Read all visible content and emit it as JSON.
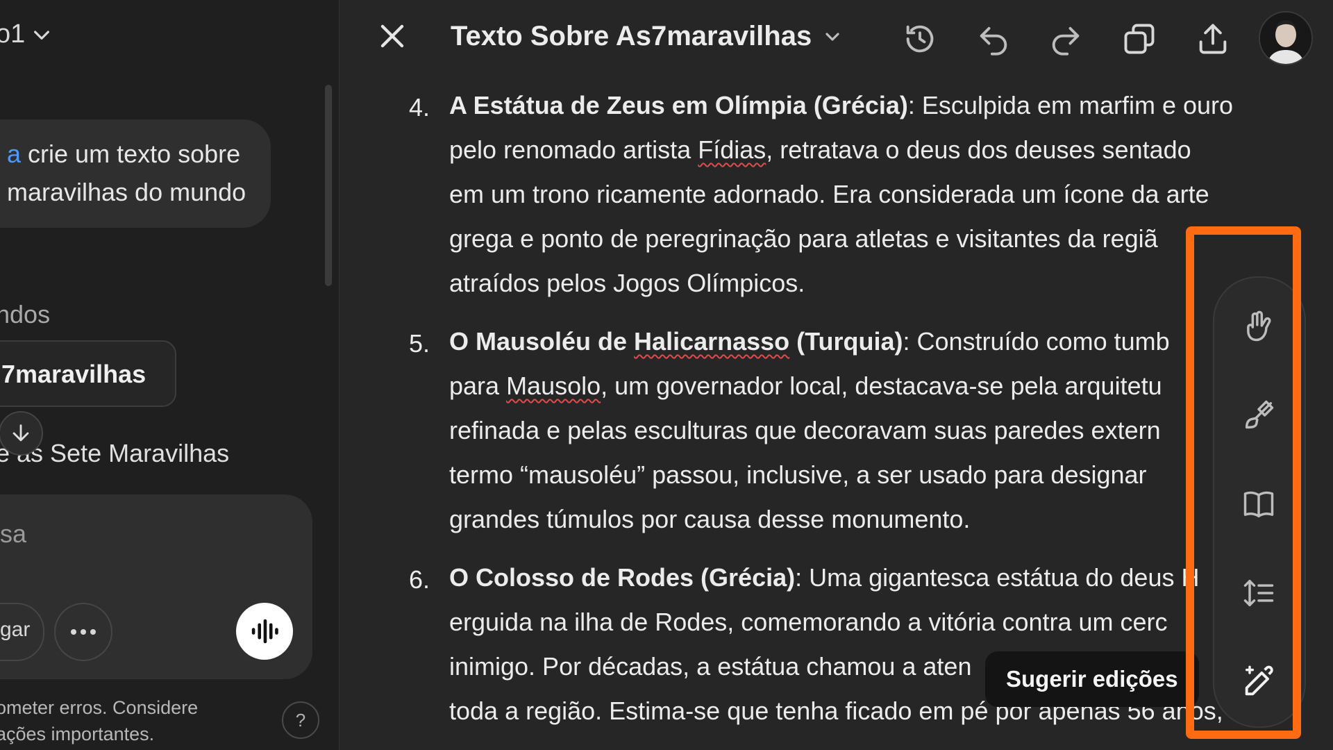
{
  "chat": {
    "model_label": "o1",
    "user_message": {
      "mention": "a",
      "line1": "crie um texto sobre",
      "line2": "maravilhas do mundo"
    },
    "section_title": "ndos",
    "doc_chip": "7maravilhas",
    "response_line": "e as Sete Maravilhas",
    "composer": {
      "placeholder": "sa",
      "attach_label": "gar"
    },
    "disclaimer": {
      "line1": "ometer erros. Considere",
      "line2": "ações importantes."
    },
    "help_label": "?"
  },
  "canvas": {
    "title": "Texto Sobre As7maravilhas",
    "toolbar": {
      "icons": [
        "history-icon",
        "undo-icon",
        "redo-icon",
        "copy-icon",
        "share-icon"
      ]
    },
    "items": [
      {
        "number": "4.",
        "heading": "A Estátua de Zeus em Olímpia (Grécia)",
        "lines": [
          ": Esculpida em marfim e ouro",
          "pelo renomado artista ",
          "em um trono ricamente adornado. Era considerada um ícone da arte",
          "grega e ponto de peregrinação para atletas e visitantes da regiã",
          "atraídos pelos Jogos Olímpicos."
        ],
        "squiggle_word": "Fídias",
        "line2_tail": ", retratava o deus dos deuses sentado"
      },
      {
        "number": "5.",
        "heading_a": "O Mausoléu de ",
        "heading_b": "Halicarnasso",
        "heading_c": " (Turquia)",
        "line1_tail": ": Construído como tumb",
        "line2_a": "para ",
        "line2_squiggle": "Mausolo",
        "line2_b": ", um governador local, destacava-se pela arquitetu",
        "line3": "refinada e pelas esculturas que decoravam suas paredes extern",
        "line4": "termo “mausoléu” passou, inclusive, a ser usado para designar",
        "line5": "grandes túmulos por causa desse monumento."
      },
      {
        "number": "6.",
        "heading": "O Colosso de Rodes (Grécia)",
        "line1_tail": ": Uma gigantesca estátua do deus H",
        "line2": "erguida na ilha de Rodes, comemorando a vitória contra um cerc",
        "line3": "inimigo. Por décadas, a estátua chamou a aten",
        "line4": "toda a região. Estima-se que tenha ficado em pé por apenas 56 anos,"
      }
    ],
    "edit_tools": {
      "icons": [
        "emoji-hand-icon",
        "paintbrush-icon",
        "book-icon",
        "text-length-icon",
        "suggest-edits-icon"
      ],
      "tooltip": "Sugerir edições"
    },
    "highlight_color": "#ff6b12"
  }
}
